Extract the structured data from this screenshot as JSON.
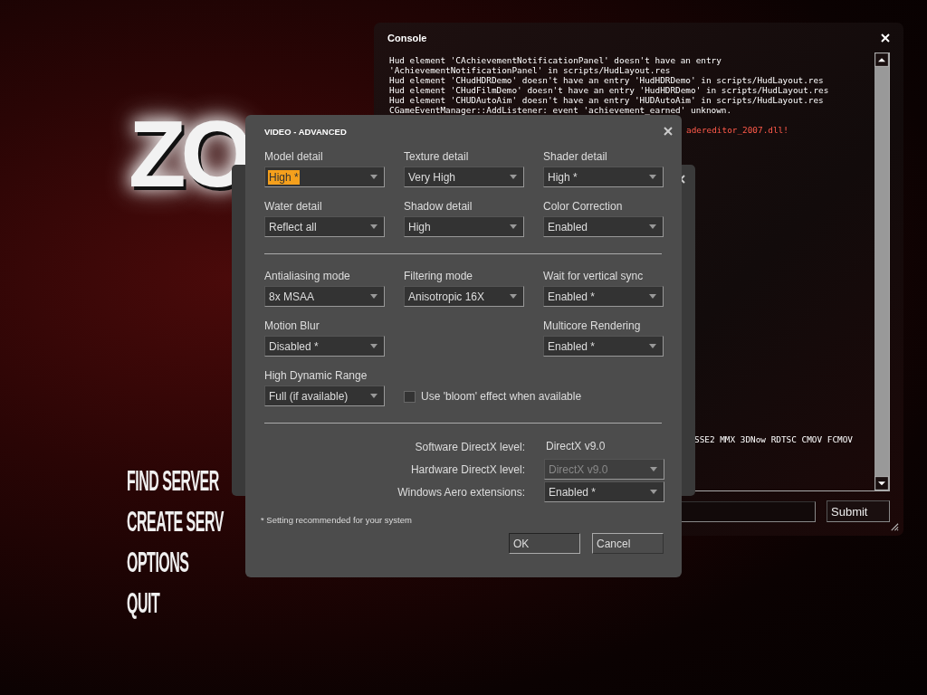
{
  "main_menu": {
    "logo": "ZO",
    "items": [
      "FIND SERVER",
      "CREATE SERV",
      "OPTIONS",
      "QUIT"
    ]
  },
  "console": {
    "title": "Console",
    "lines": [
      {
        "text": "Hud element 'CAchievementNotificationPanel' doesn't have an entry",
        "kind": "info"
      },
      {
        "text": "'AchievementNotificationPanel' in scripts/HudLayout.res",
        "kind": "info"
      },
      {
        "text": "Hud element 'CHudHDRDemo' doesn't have an entry 'HudHDRDemo' in scripts/HudLayout.res",
        "kind": "info"
      },
      {
        "text": "Hud element 'CHudFilmDemo' doesn't have an entry 'HudHDRDemo' in scripts/HudLayout.res",
        "kind": "info"
      },
      {
        "text": "Hud element 'CHUDAutoAim' doesn't have an entry 'HUDAutoAim' in scripts/HudLayout.res",
        "kind": "info"
      },
      {
        "text": "CGameEventManager::AddListener: event 'achievement_earned' unknown.",
        "kind": "info"
      },
      {
        "text": "adereditor_2007.dll!",
        "kind": "error"
      },
      {
        "text": "SSE2 MMX 3DNow RDTSC CMOV FCMOV",
        "kind": "partial"
      }
    ],
    "submit": "Submit"
  },
  "video_advanced": {
    "title": "VIDEO - ADVANCED",
    "sections": [
      [
        {
          "kind": "dropdown",
          "label": "Model detail",
          "value": "High *",
          "highlighted": true
        },
        {
          "kind": "dropdown",
          "label": "Texture detail",
          "value": "Very High",
          "highlighted": false
        },
        {
          "kind": "dropdown",
          "label": "Shader detail",
          "value": "High *",
          "highlighted": false
        },
        {
          "kind": "dropdown",
          "label": "Water detail",
          "value": "Reflect all",
          "highlighted": false
        },
        {
          "kind": "dropdown",
          "label": "Shadow detail",
          "value": "High",
          "highlighted": false
        },
        {
          "kind": "dropdown",
          "label": "Color Correction",
          "value": "Enabled",
          "highlighted": false
        }
      ],
      [
        {
          "kind": "dropdown",
          "label": "Antialiasing mode",
          "value": "8x MSAA",
          "highlighted": false
        },
        {
          "kind": "dropdown",
          "label": "Filtering mode",
          "value": "Anisotropic 16X",
          "highlighted": false
        },
        {
          "kind": "dropdown",
          "label": "Wait for vertical sync",
          "value": "Enabled *",
          "highlighted": false
        },
        {
          "kind": "dropdown",
          "label": "Motion Blur",
          "value": "Disabled *",
          "highlighted": false
        },
        {
          "kind": "spacer"
        },
        {
          "kind": "dropdown",
          "label": "Multicore Rendering",
          "value": "Enabled *",
          "highlighted": false
        },
        {
          "kind": "dropdown",
          "label": "High Dynamic Range",
          "value": "Full (if available)",
          "highlighted": false
        },
        {
          "kind": "checkbox",
          "label": "Use 'bloom' effect when available",
          "checked": false
        }
      ]
    ],
    "directx": [
      {
        "kind": "text",
        "label": "Software DirectX level:",
        "value": "DirectX v9.0"
      },
      {
        "kind": "dropdown",
        "label": "Hardware DirectX level:",
        "value": "DirectX v9.0",
        "disabled": true
      },
      {
        "kind": "dropdown",
        "label": "Windows Aero extensions:",
        "value": "Enabled *",
        "disabled": false
      }
    ],
    "footnote": "* Setting recommended for your system",
    "buttons": [
      "OK",
      "Cancel"
    ]
  }
}
